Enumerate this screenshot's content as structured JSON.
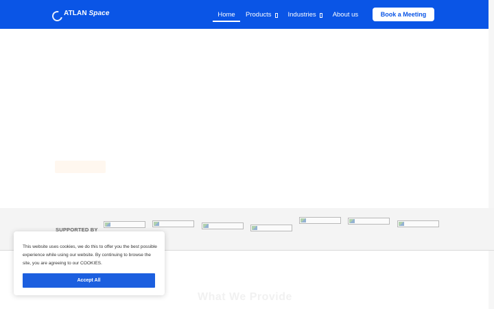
{
  "brand": {
    "name": "ATLAN",
    "name_italic": "Space"
  },
  "nav": {
    "home": "Home",
    "products": "Products",
    "industries": "Industries",
    "about": "About us"
  },
  "cta": {
    "book": "Book a Meeting"
  },
  "supported": {
    "label": "SUPPORTED BY"
  },
  "section": {
    "title": "What We Provide"
  },
  "cookie": {
    "text": "This website uses cookies, we do this to offer you the best possible experience while using our website. By continuing to browse the site, you are agreeing to our COOKIES.",
    "accept": "Accept All"
  },
  "colors": {
    "header": "#0a55e6",
    "accept_button": "#1c5fdf"
  },
  "icons": {
    "products_caret": "caret-icon",
    "industries_caret": "caret-icon"
  }
}
